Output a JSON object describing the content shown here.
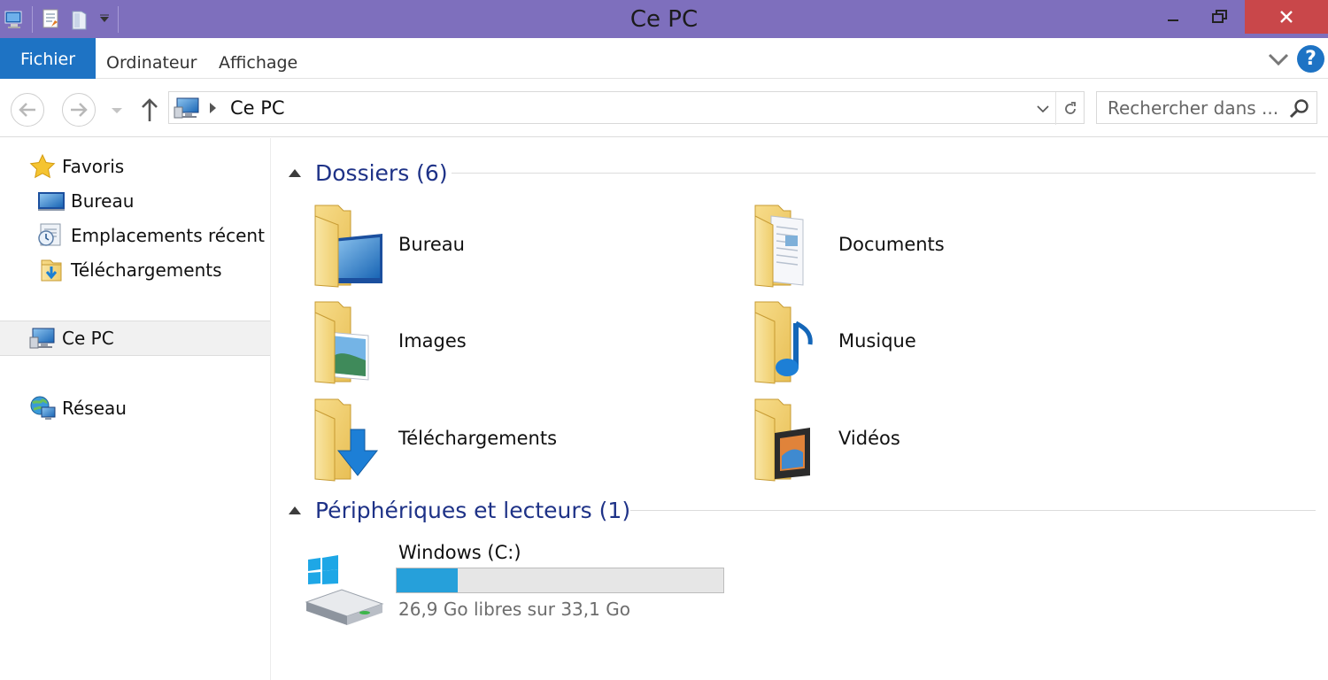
{
  "window": {
    "title": "Ce PC",
    "colors": {
      "titlebar": "#7e6fbd",
      "close": "#c9474a",
      "accent": "#1e73c4",
      "group_title": "#1e3287",
      "usage_fill": "#26a0da"
    }
  },
  "quick_access": {
    "icons": [
      "computer-icon",
      "properties-icon",
      "new-folder-icon",
      "customize-dropdown-icon"
    ]
  },
  "ribbon": {
    "tabs": [
      {
        "label": "Fichier",
        "active": true
      },
      {
        "label": "Ordinateur"
      },
      {
        "label": "Affichage"
      }
    ],
    "help": "?"
  },
  "navigation": {
    "path": [
      "Ce PC"
    ],
    "search_placeholder": "Rechercher dans ..."
  },
  "sidebar": {
    "favorites": {
      "label": "Favoris",
      "items": [
        {
          "label": "Bureau",
          "icon": "desktop-icon"
        },
        {
          "label": "Emplacements récent",
          "icon": "recent-places-icon"
        },
        {
          "label": "Téléchargements",
          "icon": "downloads-icon"
        }
      ]
    },
    "this_pc": {
      "label": "Ce PC",
      "selected": true
    },
    "network": {
      "label": "Réseau"
    }
  },
  "content": {
    "folders_group": {
      "title": "Dossiers (6)"
    },
    "folders": [
      {
        "label": "Bureau",
        "icon": "desktop-folder-icon"
      },
      {
        "label": "Documents",
        "icon": "documents-folder-icon"
      },
      {
        "label": "Images",
        "icon": "pictures-folder-icon"
      },
      {
        "label": "Musique",
        "icon": "music-folder-icon"
      },
      {
        "label": "Téléchargements",
        "icon": "downloads-folder-icon"
      },
      {
        "label": "Vidéos",
        "icon": "videos-folder-icon"
      }
    ],
    "devices_group": {
      "title": "Périphériques et lecteurs (1)"
    },
    "drives": [
      {
        "name": "Windows (C:)",
        "free_text": "26,9 Go libres sur 33,1 Go",
        "used_fraction": 0.187
      }
    ]
  }
}
